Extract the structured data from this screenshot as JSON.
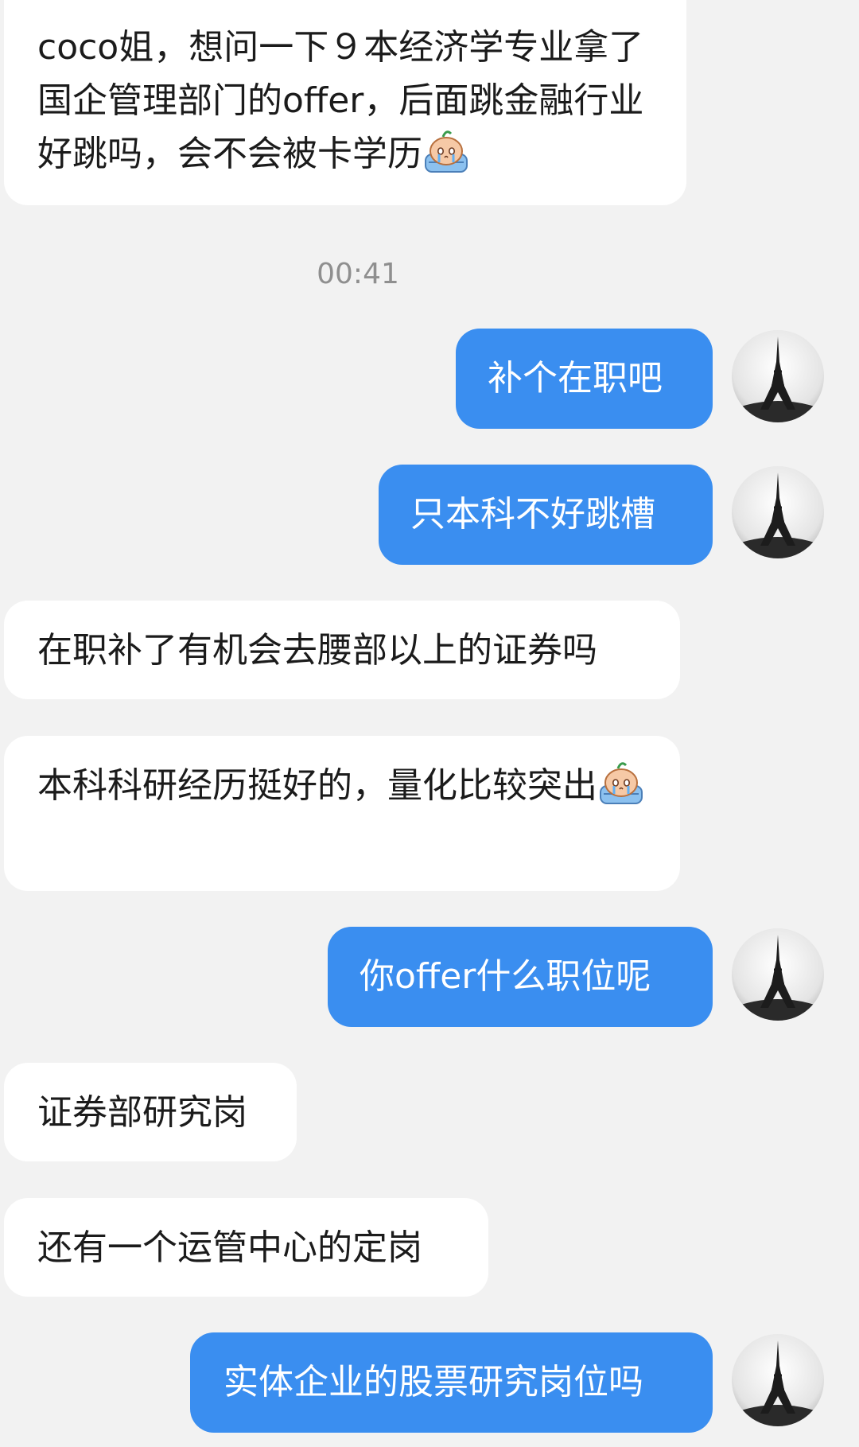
{
  "timestamp": "00:41",
  "messages": [
    {
      "text": "coco姐，想问一下９本经济学专业拿了国企管理部门的offer，后面跳金融行业好跳吗，会不会被卡学历",
      "emoji": "crying-peach-emoji"
    },
    {
      "text": "补个在职吧"
    },
    {
      "text": "只本科不好跳槽"
    },
    {
      "text": "在职补了有机会去腰部以上的证券吗"
    },
    {
      "text": "本科科研经历挺好的，量化比较突出",
      "emoji": "crying-peach-emoji"
    },
    {
      "text": "你offer什么职位呢"
    },
    {
      "text": "证券部研究岗"
    },
    {
      "text": "还有一个运管中心的定岗"
    },
    {
      "text": "实体企业的股票研究岗位吗"
    }
  ],
  "colors": {
    "background": "#f2f2f2",
    "incoming_bubble": "#ffffff",
    "outgoing_bubble": "#3a8ef0"
  },
  "avatar_icon": "eiffel-tower-avatar"
}
